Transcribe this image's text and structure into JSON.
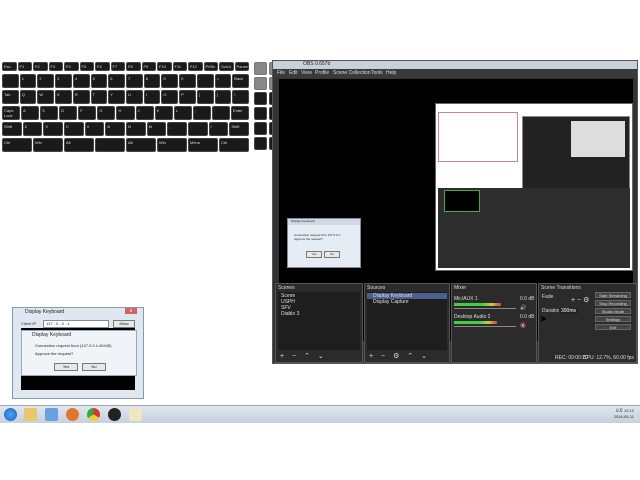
{
  "keyboard": {
    "fn_row": [
      "Esc",
      "F1",
      "F2",
      "F3",
      "F4",
      "F5",
      "F6",
      "F7",
      "F8",
      "F9",
      "F10",
      "F11",
      "F12",
      "PrtSc",
      "ScrLk",
      "Pause"
    ],
    "row1": [
      "`",
      "1",
      "2",
      "3",
      "4",
      "5",
      "6",
      "7",
      "8",
      "9",
      "0",
      "-",
      "=",
      "Back"
    ],
    "row2": [
      "Tab",
      "Q",
      "W",
      "E",
      "R",
      "T",
      "Y",
      "U",
      "I",
      "O",
      "P",
      "[",
      "]",
      "\\"
    ],
    "row3": [
      "Caps Lock",
      "A",
      "S",
      "D",
      "F",
      "G",
      "H",
      "J",
      "K",
      "L",
      ";",
      "'",
      "Enter"
    ],
    "row4": [
      "Shift",
      "Z",
      "X",
      "C",
      "V",
      "B",
      "N",
      "M",
      ",",
      ".",
      "/",
      "Shift"
    ],
    "row5": [
      "Ctrl",
      "Win",
      "Alt",
      "",
      "Alt",
      "Win",
      "Menu",
      "Ctrl"
    ]
  },
  "obs": {
    "title": "OBS 0.657b",
    "menu": [
      "File",
      "Edit",
      "View",
      "Profile",
      "Scene Collection",
      "Tools",
      "Help"
    ],
    "scenes": {
      "title": "Scenes",
      "items": [
        "Scene",
        "USPH",
        "SFV",
        "Diablo 3"
      ]
    },
    "sources": {
      "title": "Sources",
      "items": [
        "Display Keyboard",
        "Display Capture"
      ]
    },
    "mixer": {
      "title": "Mixer",
      "tracks": [
        {
          "name": "Mic/AUX 1",
          "db": "0.0 dB",
          "level": 0.75
        },
        {
          "name": "Desktop Audio 2",
          "db": "0.0 dB",
          "level": 0.7
        }
      ]
    },
    "transitions": {
      "title": "Scene Transitions",
      "fade": "Fade",
      "duration_label": "Duration",
      "duration_value": "300ms"
    },
    "controls": [
      "Start Streaming",
      "Stop Recording",
      "Studio Mode",
      "Settings",
      "Exit"
    ],
    "status": {
      "rec": "REC: 00:00:20",
      "cpu": "CPU: 12.7%, 60.00 fps"
    }
  },
  "small_dialog": {
    "title": "Display Keyboard",
    "message": "Connection request from 127.0.0.1 Approve the request?",
    "yes": "Yes",
    "no": "No"
  },
  "display_keyboard": {
    "title": "Display Keyboard",
    "field_label": "Client IP",
    "field_value": "127 . 0 . 0 . 1",
    "allow_button": "Allow",
    "dialog": {
      "title": "Display Keyboard",
      "message": "Connection request from (127.0.0.1:49445).",
      "question": "Approve the request?",
      "yes": "Yes",
      "no": "No"
    }
  },
  "taskbar": {
    "icons": [
      "start-orb",
      "explorer",
      "media",
      "firefox",
      "chrome",
      "obs",
      "keyboard-app"
    ],
    "time": "오후 12:12",
    "date": "2016-05-11"
  },
  "colors": {
    "obs_bg": "#333333",
    "taskbar": "#c5d1de",
    "accent": "#4a5f8e"
  }
}
